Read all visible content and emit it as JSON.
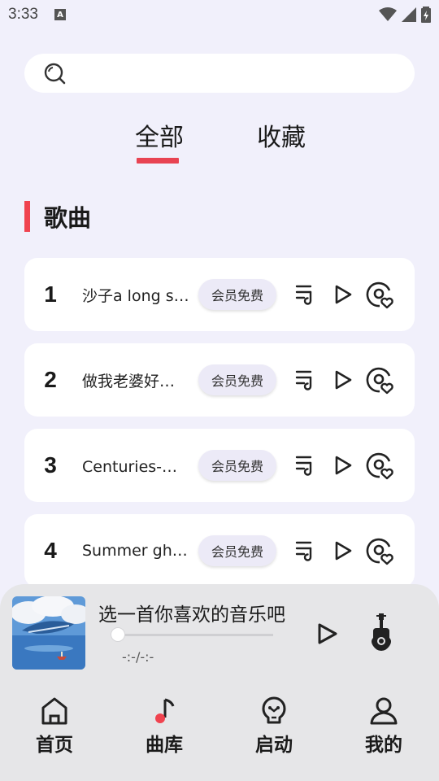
{
  "status_bar": {
    "time": "3:33",
    "notification_letter": "A"
  },
  "search": {
    "placeholder": "",
    "value": ""
  },
  "tabs": [
    {
      "label": "全部",
      "active": true
    },
    {
      "label": "收藏",
      "active": false
    }
  ],
  "section": {
    "title": "歌曲"
  },
  "songs": [
    {
      "num": "1",
      "title": "沙子a long s…",
      "badge": "会员免费"
    },
    {
      "num": "2",
      "title": "做我老婆好…",
      "badge": "会员免费"
    },
    {
      "num": "3",
      "title": "Centuries-蓝…",
      "badge": "会员免费"
    },
    {
      "num": "4",
      "title": "Summer gho…",
      "badge": "会员免费"
    }
  ],
  "player": {
    "title": "选一首你喜欢的音乐吧",
    "time": "-:-/-:-",
    "progress": 0
  },
  "nav": [
    {
      "label": "首页",
      "icon": "home-icon"
    },
    {
      "label": "曲库",
      "icon": "music-note-icon"
    },
    {
      "label": "启动",
      "icon": "launch-icon"
    },
    {
      "label": "我的",
      "icon": "person-icon"
    }
  ],
  "colors": {
    "accent": "#f0434f",
    "background": "#f1f0fb",
    "card": "#ffffff",
    "player_bg": "#e6e6e8"
  }
}
